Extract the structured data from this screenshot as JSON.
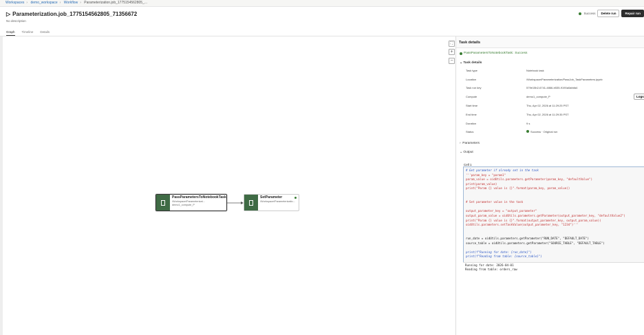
{
  "breadcrumb": [
    "Workspaces",
    "demo_workspace",
    "Workflow",
    "Parameterization.job_1775154562805_..."
  ],
  "header": {
    "title": "Parameterization.job_1775154562805_71356672",
    "description": "No description",
    "status": "Success",
    "delete_label": "Delete run",
    "repair_label": "Repair run"
  },
  "tabs": [
    "Graph",
    "Timeline",
    "Details"
  ],
  "graph": {
    "nodes": [
      {
        "name": "PassParametersToNotebookTask",
        "path": "/Workspace/Parameterizat...",
        "compute": "demo1_compute_P"
      },
      {
        "name": "SetParameter",
        "path": "/Workspace/Parameterizatio...",
        "compute": ""
      }
    ]
  },
  "panel": {
    "title": "Task details",
    "task_name": "PassParametersToNotebookTask:",
    "task_status": "Success",
    "section": "Task details",
    "rows": [
      {
        "k": "Task type",
        "v": "Notebook task"
      },
      {
        "k": "Location",
        "v": "/Workspace/Parameterization/PassJob_TaskParameters.ipynb"
      },
      {
        "k": "Task run key",
        "v": "579e15b2-6741-4866-b535-9190a0afafa4"
      },
      {
        "k": "Compute",
        "v": "demo1_compute_P"
      },
      {
        "k": "Start time",
        "v": "Thu, Apr 02, 2026 at 11:29:25 PST"
      },
      {
        "k": "End time",
        "v": "Thu, Apr 02, 2026 at 11:29:35 PST"
      },
      {
        "k": "Duration",
        "v": "9 s"
      },
      {
        "k": "Status",
        "v": "Success · Original run"
      }
    ],
    "logs_label": "Logs",
    "parameters_label": "Parameters",
    "output_label": "Output",
    "cell_label": "Cell 1",
    "code": [
      {
        "t": "c",
        "s": "# Get parameter if already set in the task"
      },
      {
        "t": "r",
        "s": "'''param_key = \"param1\""
      },
      {
        "t": "r",
        "s": "param_value = oidUtils.parameters.getParameter(param_key, \"defaultValue\")"
      },
      {
        "t": "r",
        "s": "print(param_value)"
      },
      {
        "t": "r",
        "s": "print(\"Param {} value is {}\".format(param_key, param_value))"
      },
      {
        "t": "r",
        "s": ""
      },
      {
        "t": "r",
        "s": ""
      },
      {
        "t": "r",
        "s": "# Set parameter value in the task"
      },
      {
        "t": "r",
        "s": ""
      },
      {
        "t": "r",
        "s": "output_parameter_key = \"output_parameter\""
      },
      {
        "t": "r",
        "s": "output_param_value = oidUtils.parameters.getParameter(output_parameter_key, \"defaultValue2\")"
      },
      {
        "t": "r",
        "s": "print(\"Param {} value is {}\".format(output_parameter_key, output_param_value))"
      },
      {
        "t": "r",
        "s": "oidUtils.parameters.setTaskValue(output_parameter_key, \"1234\")'''"
      },
      {
        "t": "k",
        "s": ""
      },
      {
        "t": "k",
        "s": ""
      },
      {
        "t": "k",
        "s": "run_date = oidUtils.parameters.getParameter(\"RUN_DATE\", \"DEFAULT_DATE\")"
      },
      {
        "t": "k",
        "s": "source_table = oidUtils.parameters.getParameter(\"SOURCE_TABLE\", \"DEFAULT_TABLE\")"
      },
      {
        "t": "k",
        "s": ""
      },
      {
        "t": "c",
        "s": "print(f\"Running for date: {run_date}\")"
      },
      {
        "t": "c",
        "s": "print(f\"Reading from table: {source_table}\")"
      }
    ],
    "output": [
      "Running for date: 2026-04-01",
      "Reading from table: orders_raw"
    ]
  }
}
